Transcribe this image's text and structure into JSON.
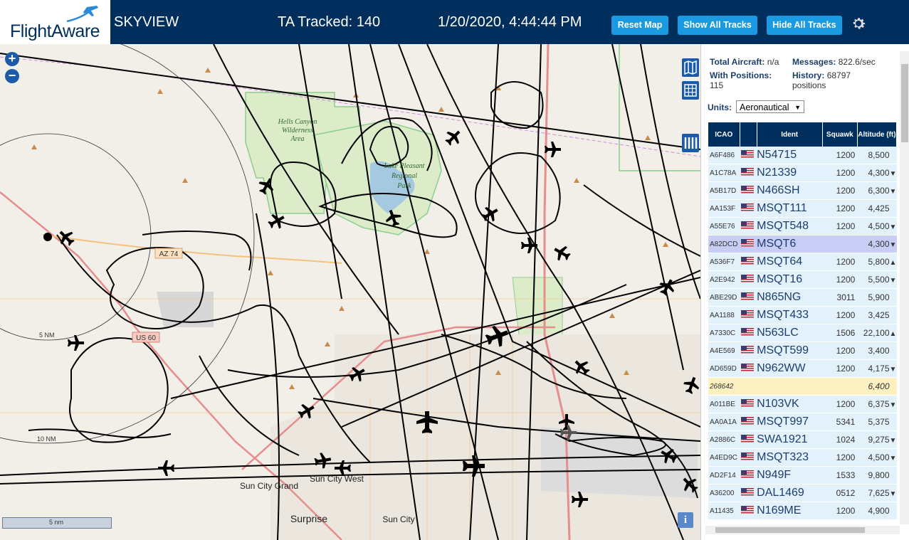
{
  "header": {
    "logo_text": "FlightAware",
    "title": "SKYVIEW",
    "tracked": "TA Tracked: 140",
    "datetime": "1/20/2020, 4:44:44 PM",
    "buttons": [
      "Reset Map",
      "Show All Tracks",
      "Hide All Tracks"
    ]
  },
  "map": {
    "labels": {
      "hells_canyon": [
        "Hells Canyon",
        "Wilderness",
        "Area"
      ],
      "lake_pleasant": [
        "Lake Pleasant",
        "Regional",
        "Park"
      ],
      "az74": "AZ 74",
      "us60": "US 60",
      "sun_city_grand": "Sun City Grand",
      "sun_city_west": "Sun City West",
      "surprise": "Surprise",
      "sun_city": "Sun City",
      "ring5": "5 NM",
      "ring10": "10 NM"
    },
    "scale_label": "5 nm",
    "zoom_in": "+",
    "zoom_out": "−",
    "info": "i"
  },
  "sidebar": {
    "total_aircraft_label": "Total Aircraft:",
    "total_aircraft_value": "n/a",
    "messages_label": "Messages:",
    "messages_value": "822.6/sec",
    "with_positions_label": "With Positions:",
    "with_positions_value": "115",
    "history_label": "History:",
    "history_value": "68797",
    "history_unit": "positions",
    "units_label": "Units:",
    "units_value": "Aeronautical",
    "columns": [
      "ICAO",
      "",
      "Ident",
      "Squawk",
      "Altitude (ft)"
    ],
    "rows": [
      {
        "icao": "A6F486",
        "ident": "N54715",
        "squawk": "1200",
        "alt": "8,500",
        "trend": ""
      },
      {
        "icao": "A1C78A",
        "ident": "N21339",
        "squawk": "1200",
        "alt": "4,300",
        "trend": "▼"
      },
      {
        "icao": "A5B17D",
        "ident": "N466SH",
        "squawk": "1200",
        "alt": "6,300",
        "trend": "▼"
      },
      {
        "icao": "AA153F",
        "ident": "MSQT111",
        "squawk": "1200",
        "alt": "4,425",
        "trend": ""
      },
      {
        "icao": "A55E76",
        "ident": "MSQT548",
        "squawk": "1200",
        "alt": "4,500",
        "trend": "▼"
      },
      {
        "icao": "A82DCD",
        "ident": "MSQT6",
        "squawk": "",
        "alt": "4,300",
        "trend": "▼"
      },
      {
        "icao": "A536F7",
        "ident": "MSQT64",
        "squawk": "1200",
        "alt": "5,800",
        "trend": "▲"
      },
      {
        "icao": "A2E942",
        "ident": "MSQT16",
        "squawk": "1200",
        "alt": "5,500",
        "trend": "▼"
      },
      {
        "icao": "ABE29D",
        "ident": "N865NG",
        "squawk": "3011",
        "alt": "5,900",
        "trend": ""
      },
      {
        "icao": "AA1188",
        "ident": "MSQT433",
        "squawk": "1200",
        "alt": "3,425",
        "trend": ""
      },
      {
        "icao": "A7330C",
        "ident": "N563LC",
        "squawk": "1506",
        "alt": "22,100",
        "trend": "▲"
      },
      {
        "icao": "A4E569",
        "ident": "MSQT599",
        "squawk": "1200",
        "alt": "3,400",
        "trend": ""
      },
      {
        "icao": "AD659D",
        "ident": "N962WW",
        "squawk": "1200",
        "alt": "4,175",
        "trend": "▼"
      },
      {
        "icao": "268642",
        "ident": "",
        "squawk": "",
        "alt": "6,400",
        "trend": ""
      },
      {
        "icao": "A011BE",
        "ident": "N103VK",
        "squawk": "1200",
        "alt": "6,375",
        "trend": "▼"
      },
      {
        "icao": "AA0A1A",
        "ident": "MSQT997",
        "squawk": "5341",
        "alt": "5,375",
        "trend": ""
      },
      {
        "icao": "A2886C",
        "ident": "SWA1921",
        "squawk": "1024",
        "alt": "9,275",
        "trend": "▼"
      },
      {
        "icao": "A4ED9C",
        "ident": "MSQT323",
        "squawk": "1200",
        "alt": "4,500",
        "trend": "▼"
      },
      {
        "icao": "AD2F14",
        "ident": "N949F",
        "squawk": "1533",
        "alt": "9,800",
        "trend": ""
      },
      {
        "icao": "A36200",
        "ident": "DAL1469",
        "squawk": "0512",
        "alt": "7,625",
        "trend": "▼"
      },
      {
        "icao": "A11435",
        "ident": "N169ME",
        "squawk": "1200",
        "alt": "4,900",
        "trend": ""
      }
    ]
  }
}
